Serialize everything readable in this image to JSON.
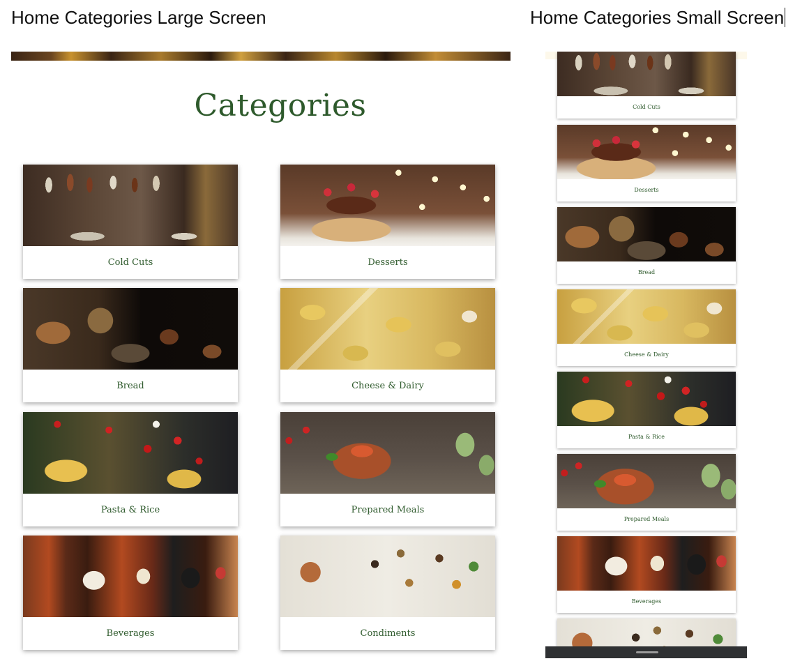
{
  "titles": {
    "large": "Home Categories Large Screen",
    "small": "Home Categories Small Screen"
  },
  "large": {
    "heading": "Categories",
    "cards": [
      {
        "label": "Cold Cuts",
        "image": "cold-cuts-image"
      },
      {
        "label": "Desserts",
        "image": "desserts-image"
      },
      {
        "label": "Bread",
        "image": "bread-image"
      },
      {
        "label": "Cheese & Dairy",
        "image": "cheese-dairy-image"
      },
      {
        "label": "Pasta & Rice",
        "image": "pasta-rice-image"
      },
      {
        "label": "Prepared Meals",
        "image": "prepared-meals-image"
      },
      {
        "label": "Beverages",
        "image": "beverages-image"
      },
      {
        "label": "Condiments",
        "image": "condiments-image"
      }
    ]
  },
  "small": {
    "cards": [
      {
        "label": "Cold Cuts"
      },
      {
        "label": "Desserts"
      },
      {
        "label": "Bread"
      },
      {
        "label": "Cheese & Dairy"
      },
      {
        "label": "Pasta & Rice"
      },
      {
        "label": "Prepared Meals"
      },
      {
        "label": "Beverages"
      },
      {
        "label": ""
      }
    ]
  },
  "colors": {
    "accent_green": "#2e5a2c",
    "phone_nav": "#2f3133"
  }
}
